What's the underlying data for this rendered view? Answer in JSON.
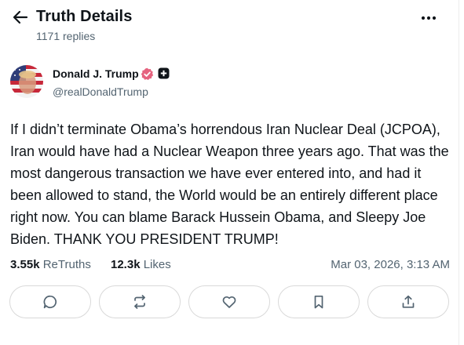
{
  "header": {
    "title": "Truth Details",
    "replies": "1171 replies",
    "back_icon": "arrow-left-icon",
    "more_icon": "more-horizontal-icon"
  },
  "author": {
    "name": "Donald J. Trump",
    "handle": "@realDonaldTrump",
    "verified_color": "#e5637f"
  },
  "post": {
    "text": "If I didn’t terminate Obama’s horrendous Iran Nuclear Deal (JCPOA), Iran would have had a Nuclear Weapon three years ago. That was the most dangerous transaction we have ever entered into, and had it been allowed to stand, the World would be an entirely different place right now. You can blame Barack Hussein Obama, and Sleepy Joe Biden. THANK YOU PRESIDENT TRUMP!"
  },
  "stats": {
    "retruths_count": "3.55k",
    "retruths_label": "ReTruths",
    "likes_count": "12.3k",
    "likes_label": "Likes",
    "timestamp": "Mar 03, 2026, 3:13 AM"
  },
  "actions": [
    {
      "icon": "reply-icon"
    },
    {
      "icon": "retruth-icon"
    },
    {
      "icon": "heart-icon"
    },
    {
      "icon": "bookmark-icon"
    },
    {
      "icon": "share-icon"
    }
  ]
}
